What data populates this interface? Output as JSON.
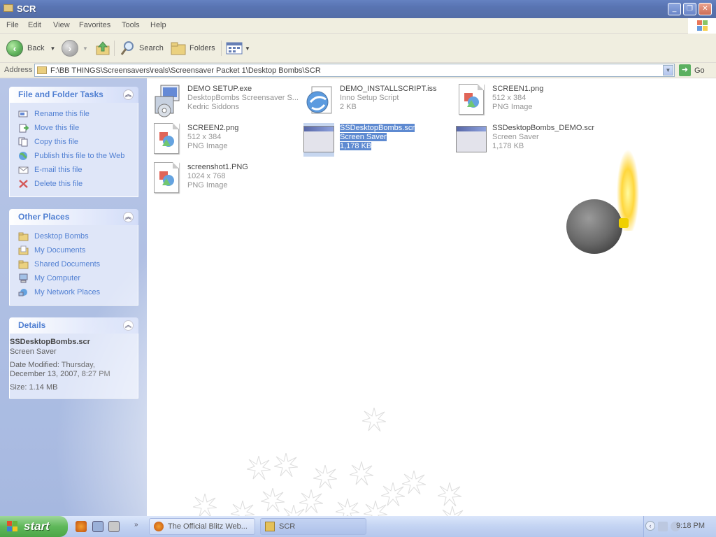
{
  "window": {
    "title": "SCR",
    "controls": {
      "minimize": "_",
      "maximize": "❐",
      "close": "✕"
    }
  },
  "menu": [
    "File",
    "Edit",
    "View",
    "Favorites",
    "Tools",
    "Help"
  ],
  "toolbar": {
    "back": "Back",
    "search": "Search",
    "folders": "Folders"
  },
  "address": {
    "label": "Address",
    "path": "F:\\BB THINGS\\Screensavers\\reals\\Screensaver Packet 1\\Desktop Bombs\\SCR",
    "go": "Go"
  },
  "tasks": {
    "title": "File and Folder Tasks",
    "items": [
      {
        "label": "Rename this file",
        "icon": "rename-icon"
      },
      {
        "label": "Move this file",
        "icon": "move-icon"
      },
      {
        "label": "Copy this file",
        "icon": "copy-icon"
      },
      {
        "label": "Publish this file to the Web",
        "icon": "globe-icon"
      },
      {
        "label": "E-mail this file",
        "icon": "email-icon"
      },
      {
        "label": "Delete this file",
        "icon": "delete-icon"
      }
    ]
  },
  "other_places": {
    "title": "Other Places",
    "items": [
      {
        "label": "Desktop Bombs",
        "icon": "folder-icon"
      },
      {
        "label": "My Documents",
        "icon": "folder-icon"
      },
      {
        "label": "Shared Documents",
        "icon": "folder-icon"
      },
      {
        "label": "My Computer",
        "icon": "computer-icon"
      },
      {
        "label": "My Network Places",
        "icon": "network-icon"
      }
    ]
  },
  "details": {
    "title": "Details",
    "name": "SSDesktopBombs.scr",
    "type": "Screen Saver",
    "modified_line1": "Date Modified: Thursday,",
    "modified_line2": "December 13, 2007, 8:27 PM",
    "size": "Size: 1.14 MB"
  },
  "files": [
    {
      "name": "DEMO SETUP.exe",
      "line2": "DesktopBombs Screensaver S...",
      "line3": "Kedric Siddons",
      "icon": "setup-icon"
    },
    {
      "name": "DEMO_INSTALLSCRIPT.iss",
      "line2": "Inno Setup Script",
      "line3": "2 KB",
      "icon": "script-icon"
    },
    {
      "name": "SCREEN1.png",
      "line2": "512 x 384",
      "line3": "PNG Image",
      "icon": "png-icon"
    },
    {
      "name": "SCREEN2.png",
      "line2": "512 x 384",
      "line3": "PNG Image",
      "icon": "png-icon"
    },
    {
      "name": "SSDesktopBombs.scr",
      "line2": "Screen Saver",
      "line3": "1,178 KB",
      "icon": "screensaver-icon",
      "selected": true
    },
    {
      "name": "SSDesktopBombs_DEMO.scr",
      "line2": "Screen Saver",
      "line3": "1,178 KB",
      "icon": "screensaver-icon"
    },
    {
      "name": "screenshot1.PNG",
      "line2": "1024 x 768",
      "line3": "PNG Image",
      "icon": "png-icon"
    }
  ],
  "taskbar": {
    "start": "start",
    "tasks": [
      {
        "label": "The Official Blitz Web...",
        "icon": "firefox-icon"
      },
      {
        "label": "SCR",
        "icon": "folder-icon"
      }
    ],
    "clock": "9:18 PM"
  },
  "colors": {
    "title_bar": "#2a4d9c",
    "task_pane": "#8ea5d8",
    "link": "#215dc6",
    "selection": "#316ac5",
    "start_green": "#4ca647",
    "flame": "#ffd23a"
  }
}
